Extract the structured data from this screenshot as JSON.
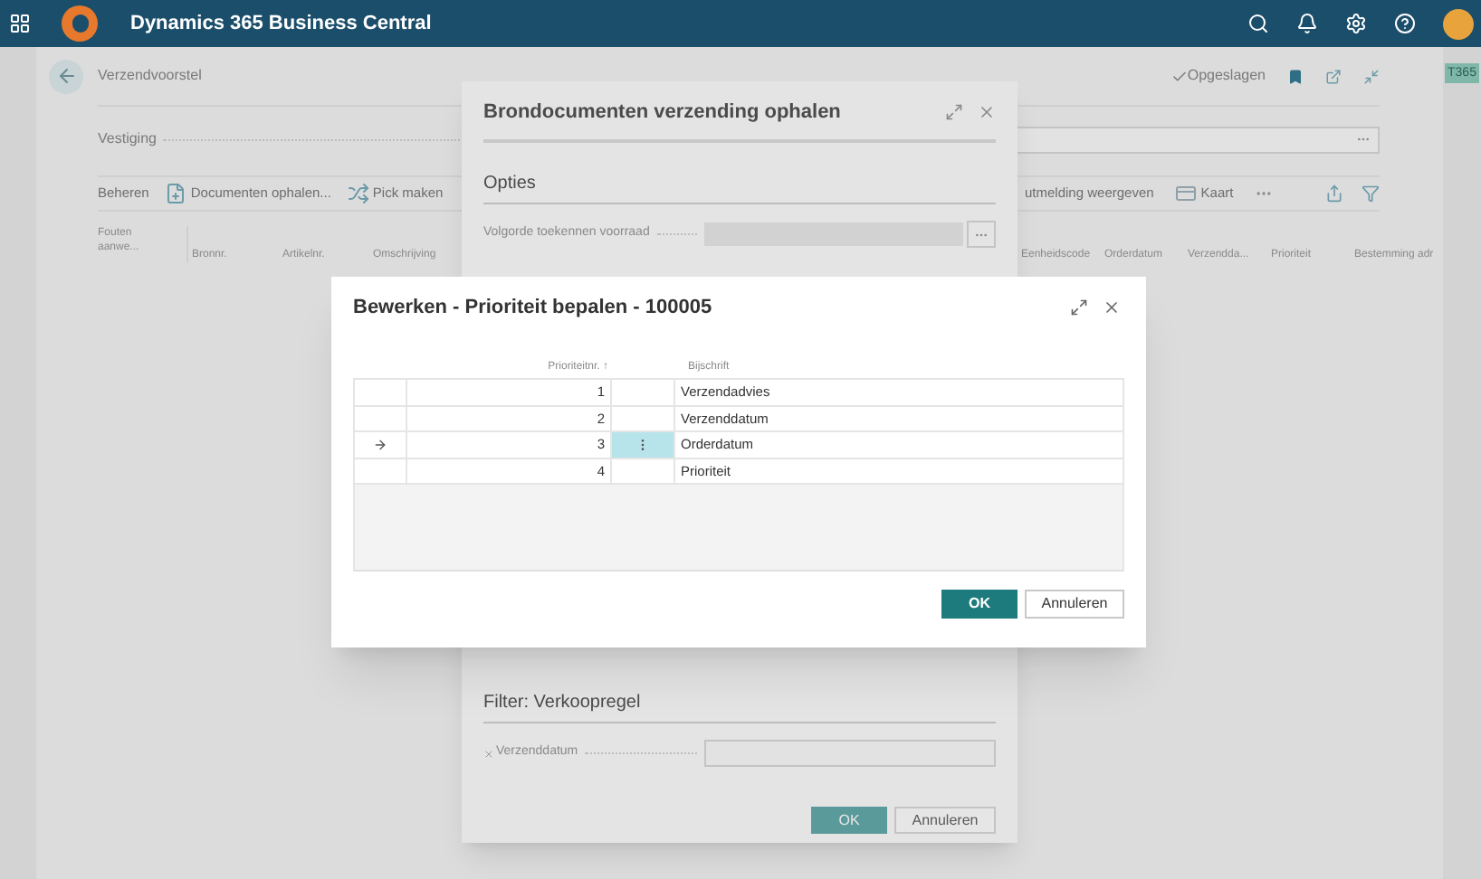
{
  "app_bar": {
    "title": "Dynamics 365 Business Central"
  },
  "page": {
    "title": "Verzendvoorstel",
    "status": "Opgeslagen",
    "badge": "T365",
    "field_label": "Vestiging",
    "actions": [
      {
        "label": "Beheren",
        "kind": "text"
      },
      {
        "label": "Documenten ophalen...",
        "kind": "document"
      },
      {
        "label": "Pick maken",
        "kind": "pick"
      }
    ],
    "actions_right": [
      {
        "label": "utmelding weergeven",
        "kind": "text"
      },
      {
        "label": "Kaart",
        "kind": "card"
      }
    ],
    "columns_left": [
      "Fouten aanwe...",
      "Bronnr.",
      "Artikelnr.",
      "Omschrijving"
    ],
    "columns_right": [
      "Eenheidscode",
      "Orderdatum",
      "Verzendda...",
      "Prioriteit",
      "Bestemming adr"
    ]
  },
  "source_dialog": {
    "title": "Brondocumenten verzending ophalen",
    "section": "Opties",
    "field_label": "Volgorde toekennen voorraad",
    "filter_section": "Filter: Verkoopregel",
    "filter_field": "Verzenddatum",
    "buttons": [
      "OK",
      "Annuleren"
    ]
  },
  "priority_dialog": {
    "title": "Bewerken - Prioriteit bepalen - 100005",
    "columns": [
      "Prioriteitnr. ↑",
      "Bijschrift"
    ],
    "rows": [
      {
        "number": "1",
        "caption": "Verzendadvies",
        "selected": false
      },
      {
        "number": "2",
        "caption": "Verzenddatum",
        "selected": false
      },
      {
        "number": "3",
        "caption": "Orderdatum",
        "selected": true
      },
      {
        "number": "4",
        "caption": "Prioriteit",
        "selected": false
      }
    ],
    "buttons": [
      "OK",
      "Annuleren"
    ]
  }
}
